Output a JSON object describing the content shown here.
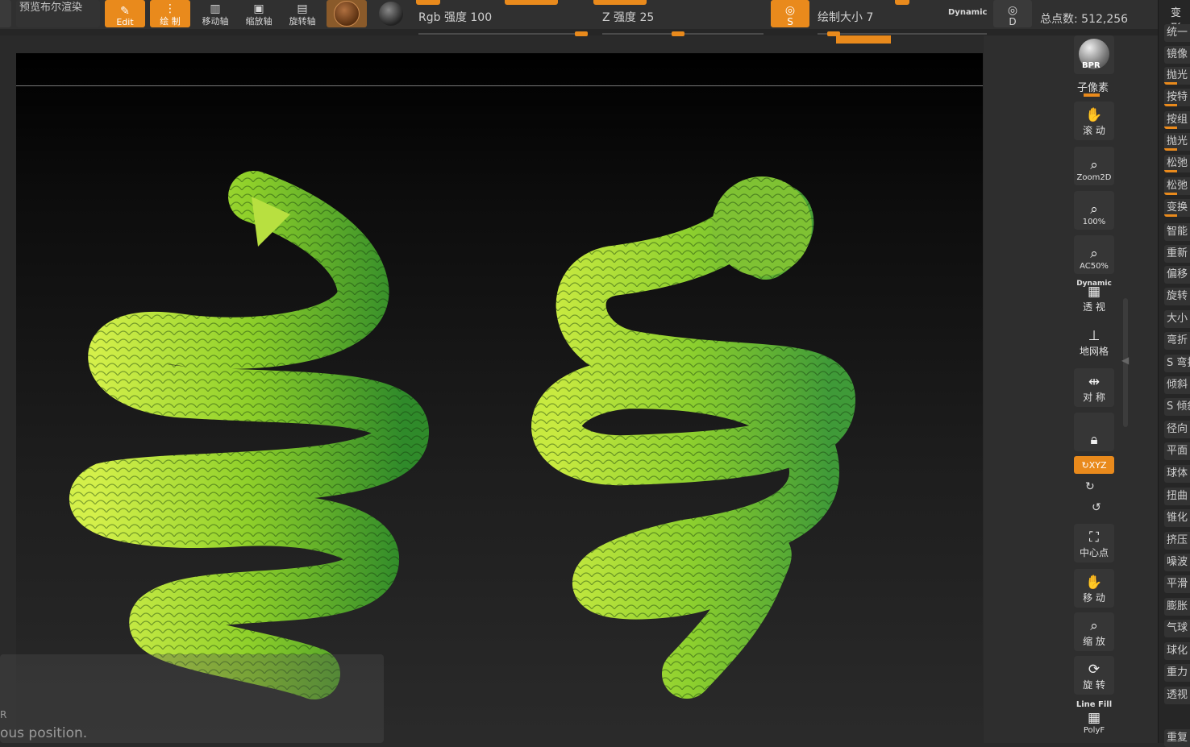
{
  "toolbar": {
    "preview_bpr": "预览布尔渲染",
    "edit": "Edit",
    "draw": "绘 制",
    "move": "移动轴",
    "scale": "缩放轴",
    "rotate": "旋转轴",
    "rgb_intensity": "Rgb 强度 100",
    "z_intensity": "Z 强度 25",
    "draw_size": "绘制大小 7",
    "dynamic": "Dynamic",
    "s_label": "S",
    "d_label": "D",
    "total_points": "总点数: 512,256",
    "accent_color": "#e98a1c"
  },
  "canvas": {
    "note_r": "R",
    "note_text": "ous position."
  },
  "shelf": {
    "bpr": "BPR",
    "subpixel": "子像素",
    "scroll": "滚 动",
    "zoom2d": "Zoom2D",
    "pct100": "100%",
    "ac50": "AC50%",
    "dynamic": "Dynamic",
    "persp": "透 视",
    "floor": "地网格",
    "sym": "对 称",
    "xyz": "XYZ",
    "center": "中心点",
    "move": "移 动",
    "scale": "缩 放",
    "rotate": "旋 转",
    "linefill": "Line Fill",
    "polyf": "PolyF"
  },
  "deformation": {
    "title": "变形",
    "items": [
      "统一",
      "镜像",
      "抛光",
      "按特",
      "按组",
      "抛光",
      "松弛",
      "松弛",
      "变换",
      "智能",
      "重新",
      "偏移",
      "旋转",
      "大小",
      "弯折",
      "S 弯折",
      "倾斜",
      "S 倾斜",
      "径向",
      "平面",
      "球体",
      "扭曲",
      "锥化",
      "挤压",
      "噪波",
      "平滑",
      "膨胀",
      "气球",
      "球化",
      "重力",
      "透视",
      "重复"
    ]
  }
}
